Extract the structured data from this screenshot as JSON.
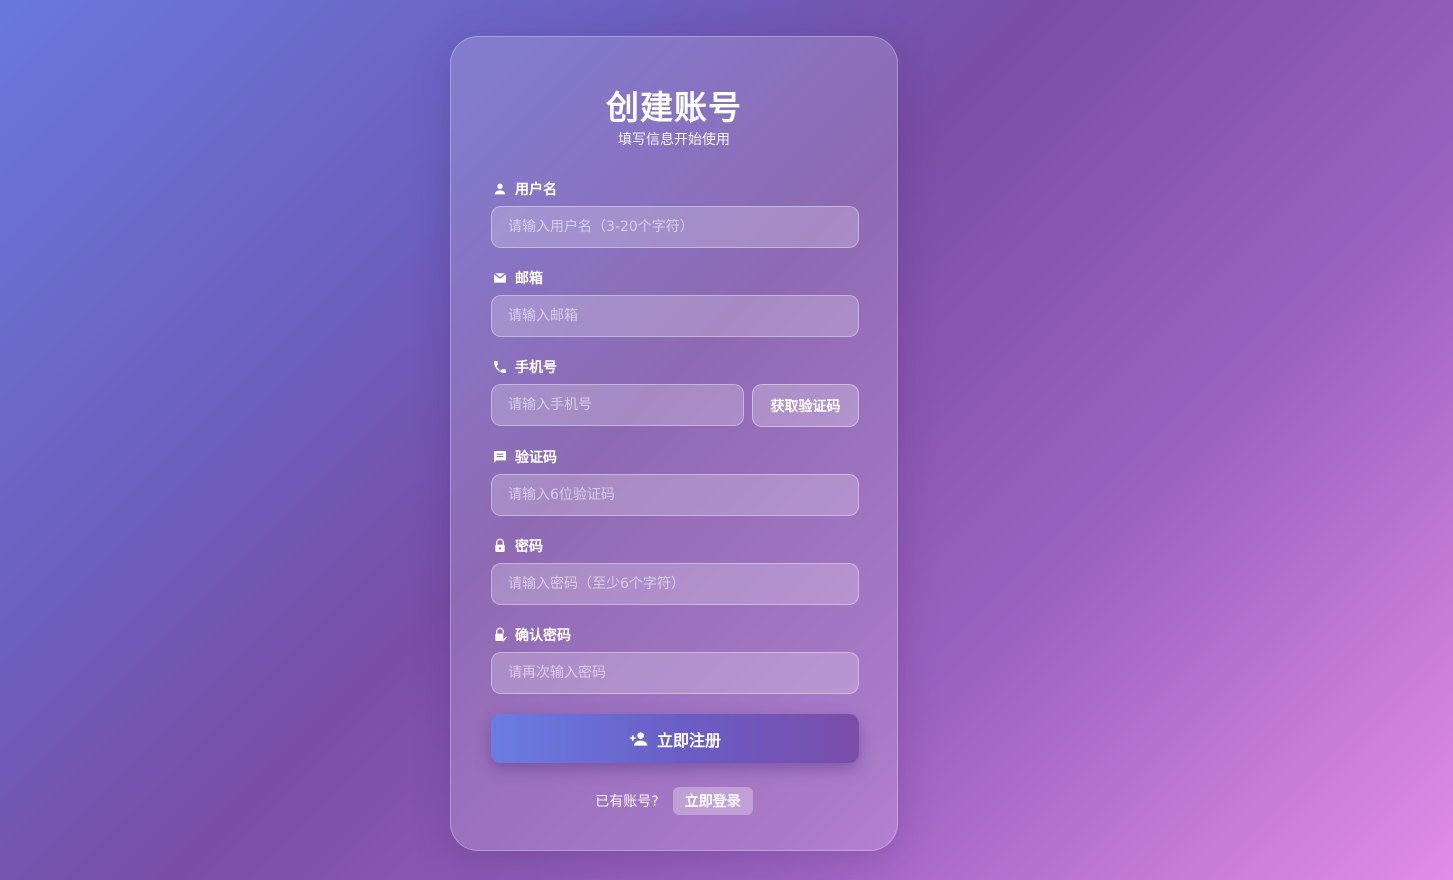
{
  "header": {
    "title": "创建账号",
    "subtitle": "填写信息开始使用"
  },
  "form": {
    "username": {
      "label": "用户名",
      "placeholder": "请输入用户名（3-20个字符）",
      "icon": "person-icon"
    },
    "email": {
      "label": "邮箱",
      "placeholder": "请输入邮箱",
      "icon": "mail-icon"
    },
    "phone": {
      "label": "手机号",
      "placeholder": "请输入手机号",
      "icon": "phone-icon",
      "get_code_label": "获取验证码"
    },
    "code": {
      "label": "验证码",
      "placeholder": "请输入6位验证码",
      "icon": "message-icon"
    },
    "password": {
      "label": "密码",
      "placeholder": "请输入密码（至少6个字符）",
      "icon": "lock-icon"
    },
    "confirm_password": {
      "label": "确认密码",
      "placeholder": "请再次输入密码",
      "icon": "lock-check-icon"
    }
  },
  "submit": {
    "label": "立即注册",
    "icon": "person-add-icon"
  },
  "footer": {
    "text": "已有账号?",
    "login_label": "立即登录"
  },
  "colors": {
    "accent_start": "#6a7de2",
    "accent_end": "#7a4ea9",
    "background_start": "#6a78dc",
    "background_end": "#e28ce8"
  }
}
